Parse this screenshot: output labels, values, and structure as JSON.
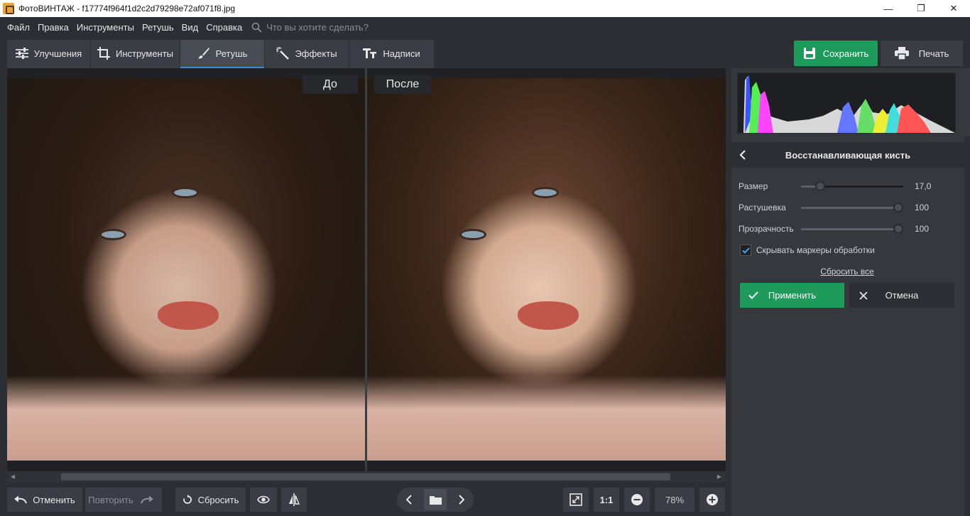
{
  "window": {
    "title": "ФотоВИНТАЖ - f17774f964f1d2c2d79298e72af071f8.jpg",
    "minimize": "—",
    "maximize": "❐",
    "close": "✕"
  },
  "menu": {
    "items": [
      "Файл",
      "Правка",
      "Инструменты",
      "Ретушь",
      "Вид",
      "Справка"
    ],
    "search_placeholder": "Что вы хотите сделать?"
  },
  "tabs": [
    {
      "label": "Улучшения",
      "icon": "sliders-icon"
    },
    {
      "label": "Инструменты",
      "icon": "crop-icon"
    },
    {
      "label": "Ретушь",
      "icon": "brush-icon",
      "active": true
    },
    {
      "label": "Эффекты",
      "icon": "magic-wand-icon"
    },
    {
      "label": "Надписи",
      "icon": "text-icon"
    }
  ],
  "actions": {
    "save": "Сохранить",
    "print": "Печать"
  },
  "preview": {
    "before_label": "До",
    "after_label": "После"
  },
  "panel": {
    "title": "Восстанавливающая кисть",
    "sliders": [
      {
        "label": "Размер",
        "value": "17,0",
        "fraction": 0.15
      },
      {
        "label": "Растушевка",
        "value": "100",
        "fraction": 1.0
      },
      {
        "label": "Прозрачность",
        "value": "100",
        "fraction": 1.0
      }
    ],
    "checkbox": {
      "label": "Скрывать маркеры обработки",
      "checked": true
    },
    "reset_all": "Сбросить все",
    "apply": "Применить",
    "cancel": "Отмена"
  },
  "bottom": {
    "undo": "Отменить",
    "redo": "Повторить",
    "reset": "Сбросить",
    "ratio": "1:1",
    "zoom": "78%"
  },
  "colors": {
    "accent_green": "#1e9a5b",
    "accent_blue": "#3d8cd1",
    "bg": "#2b2e33"
  }
}
